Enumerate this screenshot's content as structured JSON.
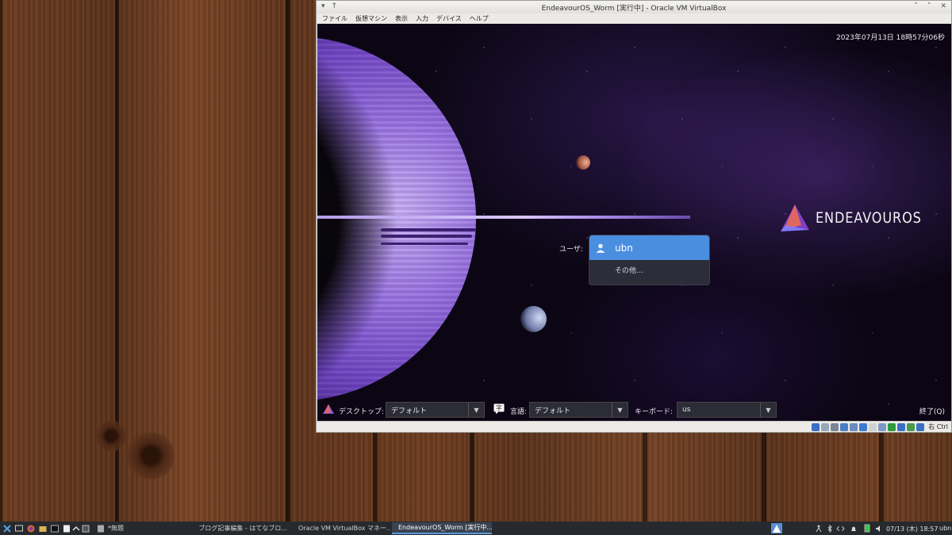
{
  "window": {
    "title": "EndeavourOS_Worm [実行中] - Oracle VM VirtualBox",
    "menu": [
      "ファイル",
      "仮想マシン",
      "表示",
      "入力",
      "デバイス",
      "ヘルプ"
    ],
    "tb_left": [
      "▾",
      "↑"
    ],
    "tb_right": [
      "˅",
      "˄",
      "✕"
    ]
  },
  "login": {
    "datetime": "2023年07月13日 18時57分06秒",
    "logo_text": "ENDEAVOUROS",
    "user_label": "ユーザ:",
    "selected_user": "ubn",
    "other_user": "その他...",
    "desktop_label": "デスクトップ:",
    "desktop_value": "デフォルト",
    "language_label": "言語:",
    "language_value": "デフォルト",
    "keyboard_label": "キーボード:",
    "keyboard_value": "us",
    "quit_label": "終了(Q)",
    "dropdown_arrow": "▼"
  },
  "statusbar": {
    "host_key": "右 Ctrl",
    "icon_colors": [
      "#3a6fc4",
      "#9aa6b8",
      "#7a8696",
      "#4a7cc8",
      "#6a8bc0",
      "#3c7bd0",
      "#d0d0d0",
      "#7a9ac6",
      "#2f9a3c",
      "#3a6fc4",
      "#4a9a4a",
      "#3a6fc4"
    ]
  },
  "taskbar": {
    "tasks": [
      {
        "label": "*無題",
        "active": false
      },
      {
        "label": "ブログ記事編集 - はてなブロ...",
        "active": false
      },
      {
        "label": "Oracle VM VirtualBox マネー...",
        "active": false
      },
      {
        "label": "EndeavourOS_Worm [実行中...",
        "active": true
      }
    ],
    "clock": "07/13 (木) 18:57",
    "user": "ubn"
  }
}
